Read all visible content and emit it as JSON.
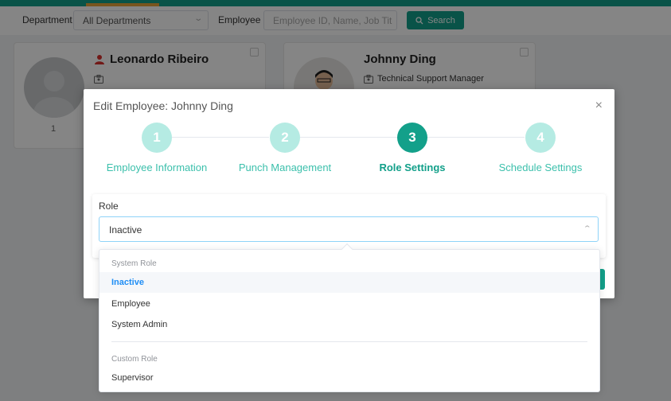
{
  "filters": {
    "department_label": "Department",
    "department_value": "All Departments",
    "employee_label": "Employee",
    "employee_placeholder": "Employee ID, Name, Job Tit",
    "search_label": "Search"
  },
  "cards": [
    {
      "name": "Leonardo Ribeiro",
      "id": "1",
      "title": ""
    },
    {
      "name": "Johnny Ding",
      "id": "",
      "title": "Technical Support Manager"
    }
  ],
  "modal": {
    "title": "Edit Employee: Johnny Ding",
    "steps": [
      {
        "number": "1",
        "label": "Employee Information"
      },
      {
        "number": "2",
        "label": "Punch Management"
      },
      {
        "number": "3",
        "label": "Role Settings"
      },
      {
        "number": "4",
        "label": "Schedule Settings"
      }
    ],
    "active_step": 3,
    "role_label": "Role",
    "role_value": "Inactive"
  },
  "dropdown": {
    "groups": [
      {
        "title": "System Role",
        "options": [
          "Inactive",
          "Employee",
          "System Admin"
        ]
      },
      {
        "title": "Custom Role",
        "options": [
          "Supervisor"
        ]
      }
    ],
    "selected": "Inactive"
  },
  "colors": {
    "accent": "#13a08a",
    "step_inactive": "#b5ebe3",
    "selected_option": "#1f8ef5",
    "admin_badge": "#d9302c"
  }
}
